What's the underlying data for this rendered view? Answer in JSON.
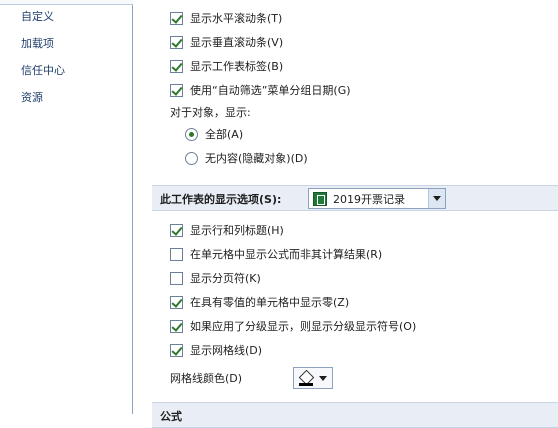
{
  "sidebar": {
    "items": [
      "自定义",
      "加载项",
      "信任中心",
      "资源"
    ]
  },
  "window_options": [
    {
      "label": "显示水平滚动条(T)",
      "checked": true
    },
    {
      "label": "显示垂直滚动条(V)",
      "checked": true
    },
    {
      "label": "显示工作表标签(B)",
      "checked": true
    },
    {
      "label": "使用“自动筛选”菜单分组日期(G)",
      "checked": true
    }
  ],
  "objects": {
    "caption": "对于对象，显示:",
    "options": [
      {
        "label": "全部(A)",
        "selected": true
      },
      {
        "label": "无内容(隐藏对象)(D)",
        "selected": false
      }
    ]
  },
  "sheet_section": {
    "title": "此工作表的显示选项(S):",
    "selected_sheet": "2019开票记录"
  },
  "sheet_options": [
    {
      "label": "显示行和列标题(H)",
      "checked": true
    },
    {
      "label": "在单元格中显示公式而非其计算结果(R)",
      "checked": false
    },
    {
      "label": "显示分页符(K)",
      "checked": false
    },
    {
      "label": "在具有零值的单元格中显示零(Z)",
      "checked": true
    },
    {
      "label": "如果应用了分级显示，则显示分级显示符号(O)",
      "checked": true
    },
    {
      "label": "显示网格线(D)",
      "checked": true
    }
  ],
  "gridline_color": {
    "label": "网格线颜色(D)"
  },
  "next_section": {
    "title": "公式"
  },
  "colors": {
    "accent": "#2a7a2a",
    "section_bg": "#e9eef6",
    "nav_text": "#1f3d6b"
  }
}
